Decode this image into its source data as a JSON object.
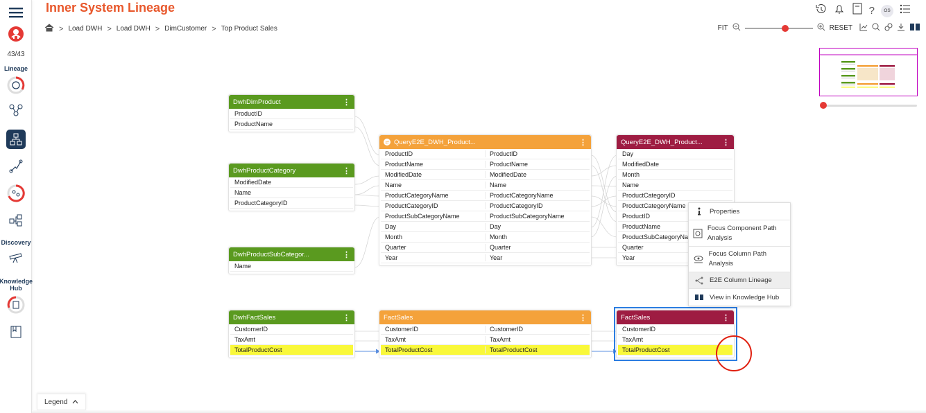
{
  "header": {
    "title": "Inner System Lineage",
    "breadcrumb": [
      "Load DWH",
      "Load DWH",
      "DimCustomer",
      "Top Product Sales"
    ],
    "avatar_initials": "OS"
  },
  "sidebar": {
    "count": "43/43",
    "sections": {
      "lineage": "Lineage",
      "discovery": "Discovery",
      "knowledge_hub": "Knowledge Hub"
    }
  },
  "toolbar": {
    "fit": "FIT",
    "reset": "RESET",
    "zoom_level": 0.6
  },
  "colors": {
    "accent": "#e8582c",
    "source": "#5a9a1f",
    "query": "#f4a23b",
    "target": "#9e1c42",
    "highlight": "#f9f83a",
    "selection": "#2b7de1"
  },
  "nodes": {
    "dwh_dim_product": {
      "title": "DwhDimProduct",
      "rows": [
        "ProductID",
        "ProductName"
      ]
    },
    "dwh_product_category": {
      "title": "DwhProductCategory",
      "rows": [
        "ModifiedDate",
        "Name",
        "ProductCategoryID"
      ]
    },
    "dwh_product_subcategory": {
      "title": "DwhProductSubCategor...",
      "rows": [
        "Name"
      ]
    },
    "dwh_fact_sales": {
      "title": "DwhFactSales",
      "rows": [
        "CustomerID",
        "TaxAmt",
        "TotalProductCost"
      ]
    },
    "query_mid": {
      "title": "QueryE2E_DWH_Product...",
      "rows": [
        [
          "ProductID",
          "ProductID"
        ],
        [
          "ProductName",
          "ProductName"
        ],
        [
          "ModifiedDate",
          "ModifiedDate"
        ],
        [
          "Name",
          "Name"
        ],
        [
          "ProductCategoryName",
          "ProductCategoryName"
        ],
        [
          "ProductCategoryID",
          "ProductCategoryID"
        ],
        [
          "ProductSubCategoryName",
          "ProductSubCategoryName"
        ],
        [
          "Day",
          "Day"
        ],
        [
          "Month",
          "Month"
        ],
        [
          "Quarter",
          "Quarter"
        ],
        [
          "Year",
          "Year"
        ]
      ]
    },
    "fact_sales_mid": {
      "title": "FactSales",
      "rows": [
        [
          "CustomerID",
          "CustomerID"
        ],
        [
          "TaxAmt",
          "TaxAmt"
        ],
        [
          "TotalProductCost",
          "TotalProductCost"
        ]
      ]
    },
    "query_right": {
      "title": "QueryE2E_DWH_Product...",
      "rows": [
        "Day",
        "ModifiedDate",
        "Month",
        "Name",
        "ProductCategoryID",
        "ProductCategoryName",
        "ProductID",
        "ProductName",
        "ProductSubCategoryNam",
        "Quarter",
        "Year"
      ]
    },
    "fact_sales_right": {
      "title": "FactSales",
      "rows": [
        "CustomerID",
        "TaxAmt",
        "TotalProductCost"
      ]
    }
  },
  "context_menu": [
    {
      "label": "Properties",
      "icon": "info-icon"
    },
    {
      "label": "Focus Component Path Analysis",
      "icon": "focus-component-icon"
    },
    {
      "label": "Focus Column Path Analysis",
      "icon": "focus-column-icon"
    },
    {
      "label": "E2E Column Lineage",
      "icon": "lineage-icon"
    },
    {
      "label": "View in Knowledge Hub",
      "icon": "book-icon"
    }
  ],
  "legend": {
    "label": "Legend"
  }
}
